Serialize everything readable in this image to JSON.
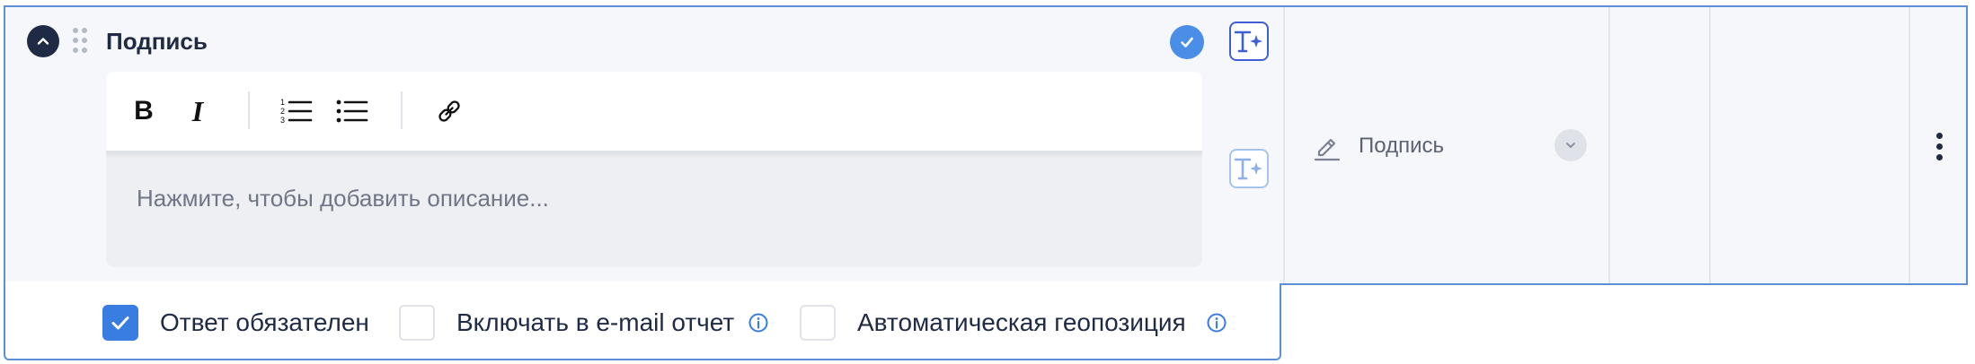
{
  "question": {
    "title": "Подпись",
    "editor": {
      "placeholder": "Нажмите, чтобы добавить описание...",
      "toolbar": {
        "bold_label": "B",
        "italic_label": "I"
      }
    }
  },
  "field_type": {
    "icon": "pencil-icon",
    "label": "Подпись"
  },
  "options": [
    {
      "label": "Ответ обязателен",
      "checked": true
    },
    {
      "label": "Включать в e-mail отчет",
      "checked": false,
      "info": true
    },
    {
      "label": "Автоматическая геопозиция",
      "checked": false,
      "info": true
    }
  ],
  "colors": {
    "accent": "#3a7de0",
    "border": "#5b8fd6",
    "dark": "#1f2a44",
    "ai_purple": "#3f5fd4"
  }
}
